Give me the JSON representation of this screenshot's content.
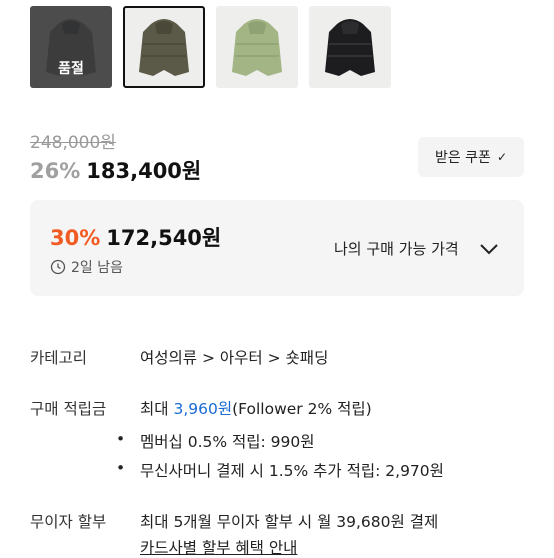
{
  "thumbnails": [
    {
      "name": "gray",
      "color": "#6d6e70",
      "soldout": true,
      "selected": false
    },
    {
      "name": "olive",
      "color": "#5b5a48",
      "soldout": false,
      "selected": true
    },
    {
      "name": "sage",
      "color": "#a3b585",
      "soldout": false,
      "selected": false
    },
    {
      "name": "black",
      "color": "#1d1d1f",
      "soldout": false,
      "selected": false
    }
  ],
  "soldout_label": "품절",
  "price": {
    "original": "248,000원",
    "discount_pct": "26%",
    "sale": "183,400원"
  },
  "coupon_button": {
    "label": "받은 쿠폰"
  },
  "my_price": {
    "discount_pct": "30%",
    "price": "172,540원",
    "time_left": "2일 남음",
    "label": "나의 구매 가능 가격"
  },
  "info": {
    "category_label": "카테고리",
    "category": [
      "여성의류",
      "아우터",
      "숏패딩"
    ],
    "points_label": "구매 적립금",
    "points_prefix": "최대",
    "points_value": "3,960원",
    "points_suffix": "(Follower 2% 적립)",
    "bullets": [
      "멤버십 0.5% 적립: 990원",
      "무신사머니 결제 시 1.5% 추가 적립: 2,970원"
    ],
    "installment_label": "무이자 할부",
    "installment_text": "최대 5개월 무이자 할부 시 월 39,680원 결제",
    "installment_link": "카드사별 할부 혜택 안내"
  },
  "colors": {
    "accent": "#f15a22",
    "link": "#1a6bd4"
  }
}
